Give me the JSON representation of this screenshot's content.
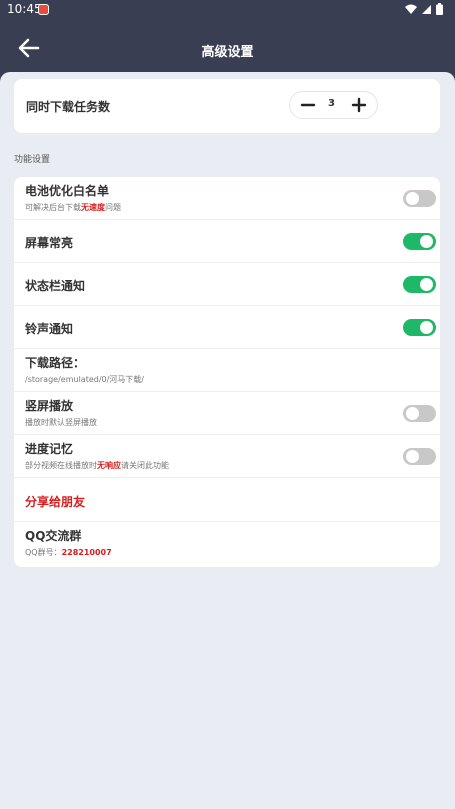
{
  "status_bar": {
    "time": "10:45"
  },
  "header": {
    "title": "高级设置"
  },
  "download_tasks": {
    "label": "同时下载任务数",
    "value": "3"
  },
  "section": {
    "title": "功能设置"
  },
  "settings": {
    "battery": {
      "title": "电池优化白名单",
      "sub_before": "可解决后台下载",
      "sub_highlight": "无速度",
      "sub_after": "问题",
      "enabled": false
    },
    "screen_on": {
      "title": "屏幕常亮",
      "enabled": true
    },
    "status_notify": {
      "title": "状态栏通知",
      "enabled": true
    },
    "ring_notify": {
      "title": "铃声通知",
      "enabled": true
    },
    "download_path": {
      "title": "下载路径：",
      "value": "/storage/emulated/0/河马下载/"
    },
    "portrait": {
      "title": "竖屏播放",
      "sub": "播放时默认竖屏播放",
      "enabled": false
    },
    "progress": {
      "title": "进度记忆",
      "sub_before": "部分视频在线播放时",
      "sub_highlight": "无响应",
      "sub_after": "请关闭此功能",
      "enabled": false
    },
    "share": {
      "title": "分享给朋友"
    },
    "qq_group": {
      "title": "QQ交流群",
      "label": "QQ群号：",
      "number": "228210007"
    }
  },
  "colors": {
    "header": "#3a3e52",
    "toggle_on": "#1fb868",
    "toggle_off": "#c8c8c8",
    "highlight": "#d71d1d"
  }
}
